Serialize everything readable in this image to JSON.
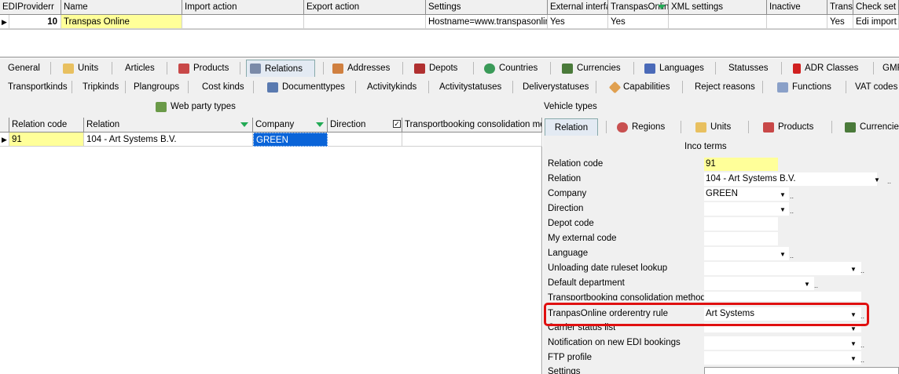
{
  "top_grid": {
    "headers": [
      "EDIProviderr",
      "Name",
      "Import action",
      "Export action",
      "Settings",
      "External interfac",
      "TranspasOnline",
      "XML settings",
      "Inactive",
      "Transp",
      "Check set"
    ],
    "row": {
      "id": "10",
      "name": "Transpas Online",
      "import": "",
      "export": "",
      "settings": "Hostname=www.transpasonline.",
      "external": "Yes",
      "transpas": "Yes",
      "xml": "",
      "inactive": "",
      "transp": "Yes",
      "check": "Edi import L"
    }
  },
  "tabs_row1": [
    "General",
    "Units",
    "Articles",
    "Products",
    "Relations",
    "Addresses",
    "Depots",
    "Countries",
    "Currencies",
    "Languages",
    "Statusses",
    "ADR Classes",
    "GMF"
  ],
  "tabs_row2": [
    "Transportkinds",
    "Tripkinds",
    "Plangroups",
    "Cost kinds",
    "Documenttypes",
    "Activitykinds",
    "Activitystatuses",
    "Deliverystatuses",
    "Capabilities",
    "Reject reasons",
    "Functions",
    "VAT codes"
  ],
  "tabs_row3": {
    "web_party": "Web party types",
    "vehicle": "Vehicle types"
  },
  "sub_grid": {
    "headers": [
      "Relation code",
      "Relation",
      "Company",
      "Direction",
      "Transportbooking consolidation meth"
    ],
    "row": {
      "code": "91",
      "relation": "104 - Art Systems B.V.",
      "company": "GREEN",
      "direction": "",
      "consol": ""
    }
  },
  "right_tabs": [
    "Relation",
    "Regions",
    "Units",
    "Products",
    "Currencie"
  ],
  "inco_terms": "Inco terms",
  "form": {
    "relation_code_label": "Relation code",
    "relation_code": "91",
    "relation_label": "Relation",
    "relation": "104 - Art Systems B.V.",
    "company_label": "Company",
    "company": "GREEN",
    "direction_label": "Direction",
    "depot_label": "Depot code",
    "myext_label": "My external code",
    "language_label": "Language",
    "unloading_label": "Unloading date ruleset lookup",
    "dept_label": "Default department",
    "consol_label": "Transportbooking consolidation method",
    "tranpas_label": "TranpasOnline orderentry rule",
    "tranpas_value": "Art Systems",
    "carrier_label": "Carrier status list",
    "notif_label": "Notification on new EDI bookings",
    "ftp_label": "FTP profile",
    "settings_label": "Settings"
  },
  "colors": {
    "highlight": "#e01010",
    "yellow": "#ffff99",
    "selection": "#0a64d8"
  }
}
